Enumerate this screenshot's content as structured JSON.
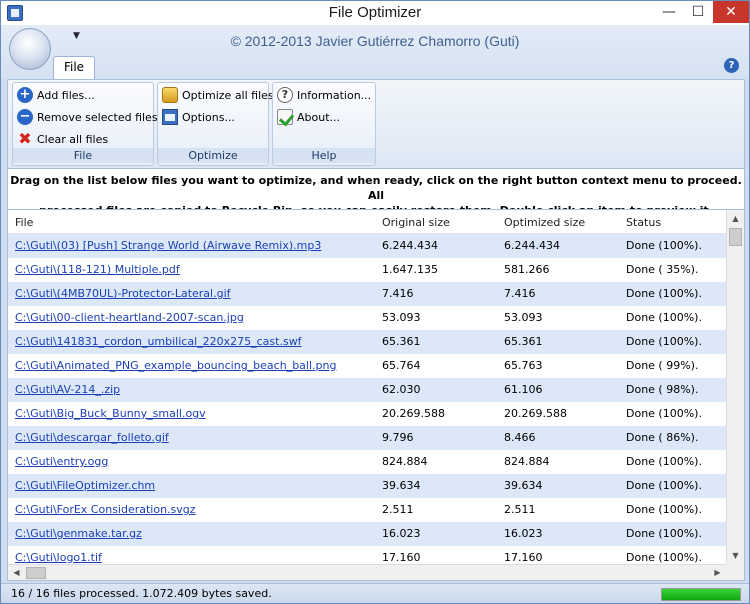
{
  "window": {
    "title": "File Optimizer",
    "subtitle": "© 2012-2013 Javier Gutiérrez Chamorro (Guti)",
    "controls": {
      "minimize": "—",
      "maximize": "☐",
      "close": "✕"
    }
  },
  "ribbon": {
    "tab": "File",
    "help": "?",
    "groups": {
      "file": {
        "label": "File",
        "add": "Add files...",
        "remove": "Remove selected files",
        "clear": "Clear all files"
      },
      "optimize": {
        "label": "Optimize",
        "optimize_all": "Optimize all files",
        "options": "Options..."
      },
      "help": {
        "label": "Help",
        "information": "Information...",
        "about": "About..."
      }
    }
  },
  "instructions": {
    "line1": "Drag on the list below files you want to optimize, and when ready, click on the right button context menu to proceed. All",
    "line2": "processed files are copied to Recycle Bin, so you can easily restore them. Double click an item to preview it."
  },
  "list": {
    "columns": [
      "File",
      "Original size",
      "Optimized size",
      "Status"
    ],
    "rows": [
      [
        "C:\\Guti\\(03) [Push] Strange World (Airwave Remix).mp3",
        "6.244.434",
        "6.244.434",
        "Done (100%)."
      ],
      [
        "C:\\Guti\\(118-121) Multiple.pdf",
        "1.647.135",
        "581.266",
        "Done ( 35%)."
      ],
      [
        "C:\\Guti\\(4MB70UL)-Protector-Lateral.gif",
        "7.416",
        "7.416",
        "Done (100%)."
      ],
      [
        "C:\\Guti\\00-client-heartland-2007-scan.jpg",
        "53.093",
        "53.093",
        "Done (100%)."
      ],
      [
        "C:\\Guti\\141831_cordon_umbilical_220x275_cast.swf",
        "65.361",
        "65.361",
        "Done (100%)."
      ],
      [
        "C:\\Guti\\Animated_PNG_example_bouncing_beach_ball.png",
        "65.764",
        "65.763",
        "Done ( 99%)."
      ],
      [
        "C:\\Guti\\AV-214_.zip",
        "62.030",
        "61.106",
        "Done ( 98%)."
      ],
      [
        "C:\\Guti\\Big_Buck_Bunny_small.ogv",
        "20.269.588",
        "20.269.588",
        "Done (100%)."
      ],
      [
        "C:\\Guti\\descargar_folleto.gif",
        "9.796",
        "8.466",
        "Done ( 86%)."
      ],
      [
        "C:\\Guti\\entry.ogg",
        "824.884",
        "824.884",
        "Done (100%)."
      ],
      [
        "C:\\Guti\\FileOptimizer.chm",
        "39.634",
        "39.634",
        "Done (100%)."
      ],
      [
        "C:\\Guti\\ForEx Consideration.svgz",
        "2.511",
        "2.511",
        "Done (100%)."
      ],
      [
        "C:\\Guti\\genmake.tar.gz",
        "16.023",
        "16.023",
        "Done (100%)."
      ],
      [
        "C:\\Guti\\logo1.tif",
        "17.160",
        "17.160",
        "Done (100%)."
      ]
    ]
  },
  "status": {
    "text": "16 / 16 files processed. 1.072.409 bytes saved.",
    "progress_percent": 100
  }
}
